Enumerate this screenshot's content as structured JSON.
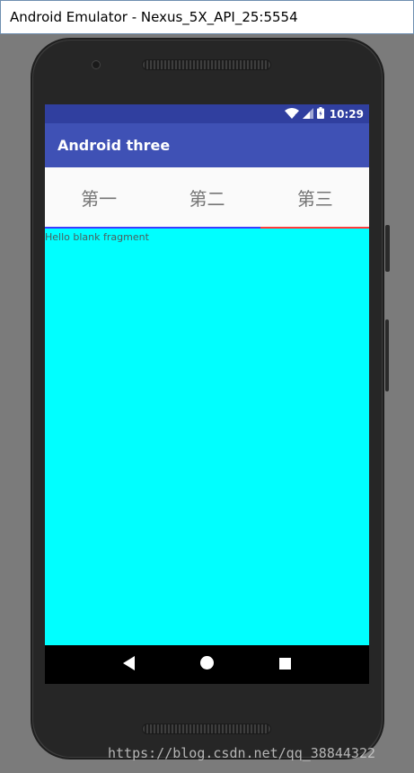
{
  "window": {
    "title": "Android Emulator - Nexus_5X_API_25:5554"
  },
  "status_bar": {
    "time": "10:29",
    "icons": [
      "wifi-icon",
      "signal-icon",
      "battery-icon"
    ]
  },
  "app_bar": {
    "title": "Android three"
  },
  "tabs": [
    {
      "label": "第一"
    },
    {
      "label": "第二"
    },
    {
      "label": "第三"
    }
  ],
  "fragment": {
    "text": "Hello blank fragment",
    "background": "#00ffff"
  },
  "navigation": [
    "back-icon",
    "home-icon",
    "recents-icon"
  ],
  "watermark": {
    "text": "https://blog.csdn.net/qq_38844322"
  },
  "colors": {
    "status_bar": "#303f9f",
    "app_bar": "#3f51b5",
    "tab_indicator_blue": "#3a3aff",
    "tab_indicator_red": "#ff3b3b"
  }
}
